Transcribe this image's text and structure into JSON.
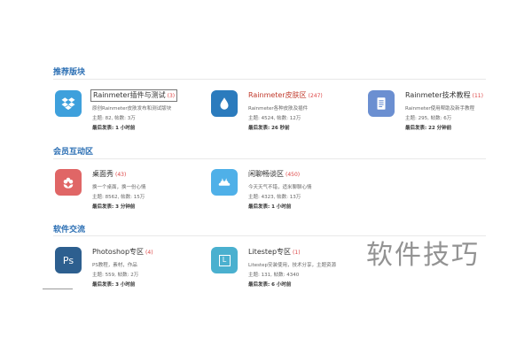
{
  "sections": [
    {
      "title": "推荐版块"
    },
    {
      "title": "会员互动区"
    },
    {
      "title": "软件交流"
    }
  ],
  "forums": [
    {
      "name": "Rainmeter插件与测试",
      "count": "(3)",
      "desc": "原创Rainmeter皮肤发布和测试版块",
      "stats": "主题: 82, 帖数: 3万",
      "last": "最后发表: 1 小时前",
      "color": "#3ea0dc",
      "icon": "dropbox-icon"
    },
    {
      "name": "Rainmeter皮肤区",
      "count": "(247)",
      "desc": "Rainmeter各种皮肤及插件",
      "stats": "主题: 4524, 帖数: 12万",
      "last": "最后发表: 26 秒前",
      "color": "#2b7bbd",
      "icon": "water-drop-icon"
    },
    {
      "name": "Rainmeter技术教程",
      "count": "(11)",
      "desc": "Rainmeter使用帮助及新手教程",
      "stats": "主题: 295, 帖数: 6万",
      "last": "最后发表: 22 分钟前",
      "color": "#6b8fd1",
      "icon": "document-icon"
    },
    {
      "name": "桌面秀",
      "count": "(43)",
      "desc": "换一个桌面，换一份心情",
      "stats": "主题: 8562, 帖数: 15万",
      "last": "最后发表: 3 分钟前",
      "color": "#e06666",
      "icon": "flower-icon"
    },
    {
      "name": "闲聊畅谈区",
      "count": "(450)",
      "desc": "今天天气不错，适米聊聊心情",
      "stats": "主题: 4323, 帖数: 13万",
      "last": "最后发表: 1 小时前",
      "color": "#4fb0e8",
      "icon": "cloud-cat-icon"
    },
    {
      "name": "Photoshop专区",
      "count": "(4)",
      "desc": "PS教程，素材，作品",
      "stats": "主题: 559, 帖数: 2万",
      "last": "最后发表: 3 小时前",
      "color": "#2d5f8f",
      "icon": "photoshop-icon"
    },
    {
      "name": "Litestep专区",
      "count": "(1)",
      "desc": "Litestep安装使用，技术分享，主题资源",
      "stats": "主题: 131, 帖数: 4340",
      "last": "最后发表: 6 小时前",
      "color": "#4ab0cf",
      "icon": "litestep-icon"
    }
  ],
  "icon_labels": {
    "photoshop": "Ps",
    "litestep": "L"
  },
  "watermark": "软件技巧"
}
